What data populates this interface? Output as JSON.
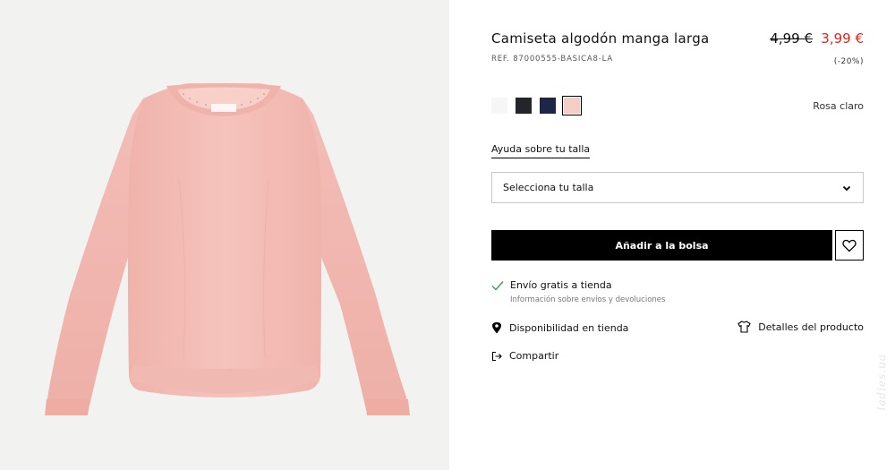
{
  "product": {
    "title": "Camiseta algodón manga larga",
    "ref": "REF. 87000555-BASICA8-LA",
    "price_old": "4,99 €",
    "price_new": "3,99 €",
    "discount": "(-20%)"
  },
  "colors": {
    "selected_name": "Rosa claro",
    "swatches": [
      {
        "icon": "white-swatch",
        "hex": "#f6f6f6"
      },
      {
        "icon": "black-swatch",
        "hex": "#23252b"
      },
      {
        "icon": "navy-swatch",
        "hex": "#1c2748"
      },
      {
        "icon": "light-pink-swatch",
        "hex": "#f4cdc7"
      }
    ],
    "accent_price": "#e2231a",
    "garment": "#f4bfb8"
  },
  "size": {
    "help_label": "Ayuda sobre tu talla",
    "select_label": "Selecciona tu talla"
  },
  "actions": {
    "add_to_bag": "Añadir a la bolsa",
    "wishlist_icon": "heart-icon"
  },
  "shipping": {
    "main": "Envío gratis a tienda",
    "sub": "Información sobre envíos y devoluciones"
  },
  "links": {
    "store_availability": "Disponibilidad en tienda",
    "product_details": "Detalles del producto",
    "share": "Compartir"
  },
  "watermark": "ladies.ua"
}
